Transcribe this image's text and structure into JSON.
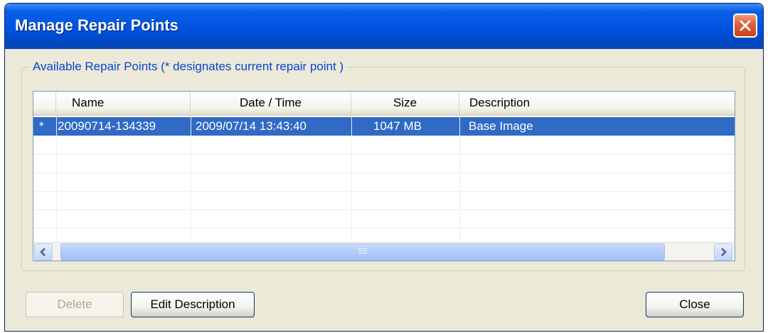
{
  "window": {
    "title": "Manage Repair Points",
    "close_icon": "close-x-icon"
  },
  "group": {
    "legend": "Available Repair Points (* designates current repair point )"
  },
  "table": {
    "columns": [
      {
        "label": "Name"
      },
      {
        "label": "Date / Time"
      },
      {
        "label": "Size"
      },
      {
        "label": "Description"
      }
    ],
    "rows": [
      {
        "marker": "*",
        "name": "20090714-134339",
        "datetime": "2009/07/14 13:43:40",
        "size": "1047 MB",
        "description": "Base Image",
        "selected": true
      }
    ]
  },
  "scrollbar": {
    "left_icon": "chevron-left-icon",
    "right_icon": "chevron-right-icon"
  },
  "buttons": {
    "delete": {
      "label": "Delete",
      "enabled": false
    },
    "edit_description": {
      "label": "Edit Description",
      "enabled": true
    },
    "close": {
      "label": "Close",
      "enabled": true
    }
  },
  "colors": {
    "titlebar": "#0055e5",
    "selection": "#316ac5",
    "legend_text": "#0046d5",
    "dialog_bg": "#ece9d8"
  }
}
